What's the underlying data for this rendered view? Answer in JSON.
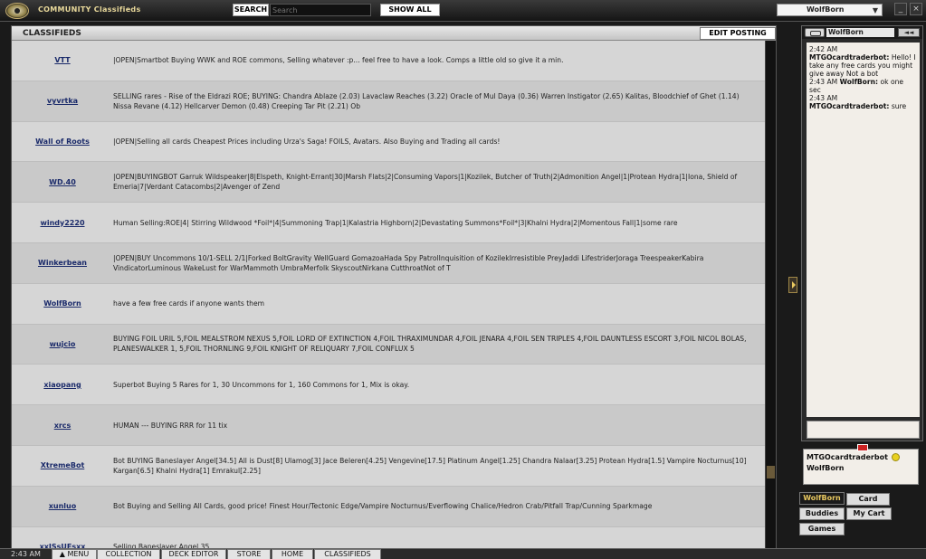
{
  "app": {
    "title": "COMMUNITY Classifieds"
  },
  "toolbar": {
    "search_label": "SEARCH",
    "search_placeholder": "Search",
    "show_all_label": "SHOW ALL",
    "user_selected": "WolfBorn"
  },
  "window_controls": {
    "minimize": "_",
    "close": "×"
  },
  "classifieds": {
    "title": "CLASSIFIEDS",
    "edit_label": "EDIT POSTING",
    "rows": [
      {
        "user": "VTT",
        "message": "|OPEN|Smartbot Buying WWK and ROE commons, Selling whatever :p... feel free to have a look. Comps a little old so give it a min."
      },
      {
        "user": "vyvrtka",
        "message": "SELLING rares - Rise of the Eldrazi ROE; BUYING: Chandra Ablaze (2.03) Lavaclaw Reaches (3.22) Oracle of Mul Daya (0.36) Warren Instigator (2.65) Kalitas, Bloodchief of Ghet (1.14) Nissa Revane (4.12) Hellcarver Demon (0.48) Creeping Tar Pit (2.21) Ob"
      },
      {
        "user": "Wall of Roots",
        "message": "|OPEN|Selling all cards Cheapest Prices including Urza's Saga! FOILS, Avatars. Also Buying and Trading all cards!"
      },
      {
        "user": "WD.40",
        "message": "|OPEN|BUYINGBOT Garruk Wildspeaker|8|Elspeth, Knight-Errant|30|Marsh Flats|2|Consuming Vapors|1|Kozilek, Butcher of Truth|2|Admonition Angel|1|Protean Hydra|1|Iona, Shield of Emeria|7|Verdant Catacombs|2|Avenger of Zend"
      },
      {
        "user": "windy2220",
        "message": "Human Selling:ROE|4| Stirring Wildwood *Foil*|4|Summoning Trap|1|Kalastria Highborn|2|Devastating Summons*Foil*|3|Khalni Hydra|2|Momentous Fall|1|some rare"
      },
      {
        "user": "Winkerbean",
        "message": "|OPEN|BUY Uncommons 10/1-SELL 2/1|Forked BoltGravity WellGuard GomazoaHada Spy PatrolInquisition of KozilekIrresistible PreyJaddi LifestriderJoraga TreespeakerKabira VindicatorLuminous WakeLust for WarMammoth UmbraMerfolk SkyscoutNirkana CutthroatNot of T"
      },
      {
        "user": "WolfBorn",
        "message": "have a few free cards if anyone wants them"
      },
      {
        "user": "wujcio",
        "message": "BUYING FOIL URIL 5,FOIL MEALSTROM NEXUS 5,FOIL LORD OF EXTINCTION 4,FOIL THRAXIMUNDAR 4,FOIL JENARA 4,FOIL SEN TRIPLES 4,FOIL DAUNTLESS ESCORT 3,FOIL NICOL BOLAS, PLANESWALKER 1, 5,FOIL THORNLING 9,FOIL KNIGHT OF RELIQUARY 7,FOIL CONFLUX 5"
      },
      {
        "user": "xiaopang",
        "message": "Superbot Buying 5 Rares for 1, 30 Uncommons for 1, 160 Commons for 1, Mix is okay."
      },
      {
        "user": "xrcs",
        "message": "HUMAN --- BUYING RRR for 11 tix"
      },
      {
        "user": "XtremeBot",
        "message": "Bot BUYING Baneslayer Angel[34.5] All is Dust[8] Ulamog[3] Jace Beleren[4.25] Vengevine[17.5] Platinum Angel[1.25] Chandra Nalaar[3.25] Protean Hydra[1.5] Vampire Nocturnus[10] Kargan[6.5] Khalni Hydra[1] Emrakul[2.25]"
      },
      {
        "user": "xunluo",
        "message": "Bot Buying and Selling All Cards, good price!    Finest Hour/Tectonic Edge/Vampire Nocturnus/Everflowing Chalice/Hedron Crab/Pitfall Trap/Cunning Sparkmage"
      },
      {
        "user": "xxISsUEsxx",
        "message": "Selling Baneslayer Angel 35"
      }
    ]
  },
  "chat": {
    "user": "WolfBorn",
    "ff": "◄◄",
    "lines": [
      {
        "time": "2:42 AM",
        "name": "",
        "text": ""
      },
      {
        "time": "",
        "name": "MTGOcardtraderbot:",
        "text": "Hello! I take any free cards you might give away Not a bot"
      },
      {
        "time": "2:43 AM",
        "name": "WolfBorn:",
        "text": "ok one sec"
      },
      {
        "time": "2:43 AM",
        "name": "",
        "text": ""
      },
      {
        "time": "",
        "name": "MTGOcardtraderbot:",
        "text": "sure"
      }
    ],
    "participants": [
      "MTGOcardtraderbot",
      "WolfBorn"
    ]
  },
  "side_tabs": {
    "wolfborn": "WolfBorn",
    "card": "Card",
    "buddies": "Buddies",
    "mycart": "My Cart",
    "games": "Games"
  },
  "bottom": {
    "clock": "2:43 AM",
    "tabs": [
      "MENU",
      "COLLECTION",
      "DECK EDITOR",
      "STORE",
      "HOME",
      "CLASSIFIEDS"
    ]
  }
}
